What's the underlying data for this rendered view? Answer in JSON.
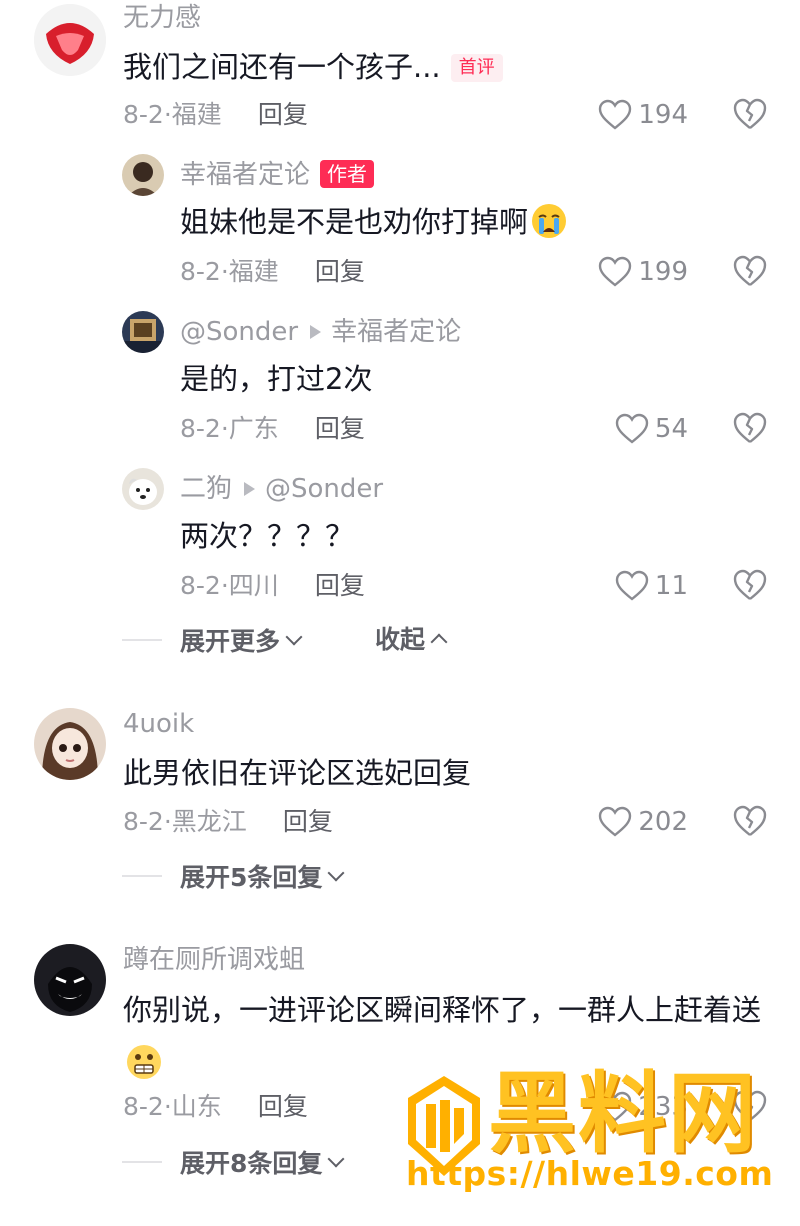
{
  "comments": [
    {
      "user": "无力感",
      "text": "我们之间还有一个孩子...",
      "badge": "首评",
      "date": "8-2",
      "location": "福建",
      "reply_label": "回复",
      "likes": "194"
    },
    {
      "user": "幸福者定论",
      "badge": "作者",
      "text": "姐妹他是不是也劝你打掉啊",
      "emoji": "crying-face",
      "date": "8-2",
      "location": "福建",
      "reply_label": "回复",
      "likes": "199"
    },
    {
      "user": "@Sonder",
      "reply_to": "幸福者定论",
      "text": "是的，打过2次",
      "date": "8-2",
      "location": "广东",
      "reply_label": "回复",
      "likes": "54"
    },
    {
      "user": "二狗",
      "reply_to": "@Sonder",
      "text": "两次？？？？",
      "date": "8-2",
      "location": "四川",
      "reply_label": "回复",
      "likes": "11"
    },
    {
      "user": "4uoik",
      "text": "此男依旧在评论区选妃回复",
      "date": "8-2",
      "location": "黑龙江",
      "reply_label": "回复",
      "likes": "202"
    },
    {
      "user": "蹲在厕所调戏蛆",
      "text": "你别说，一进评论区瞬间释怀了，一群人上赶着送",
      "emoji": "grimacing-face",
      "date": "8-2",
      "location": "山东",
      "reply_label": "回复",
      "likes": "233"
    }
  ],
  "expand": {
    "more": "展开更多",
    "collapse": "收起",
    "five_replies": "展开5条回复",
    "eight_replies": "展开8条回复"
  },
  "separator": "·",
  "watermark": {
    "title": "黑料网",
    "url": "https://hlwe19.com"
  },
  "colors": {
    "accent": "#fe2c55",
    "muted_text": "#9a9ba1",
    "watermark": "#ffc222"
  }
}
